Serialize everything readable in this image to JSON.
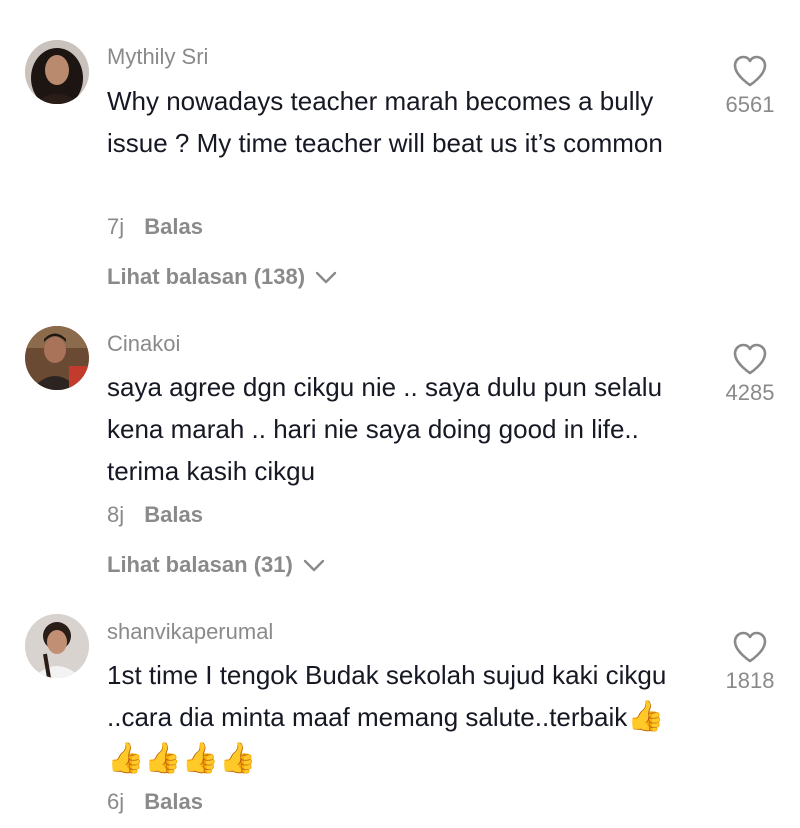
{
  "comments": [
    {
      "username": "Mythily Sri",
      "text": "Why nowadays teacher marah becomes a bully issue ? My time teacher will beat us it’s common",
      "time": "7j",
      "reply_label": "Balas",
      "view_replies": "Lihat balasan (138)",
      "likes": "6561",
      "avatar_icon": "user-avatar-woman"
    },
    {
      "username": "Cinakoi",
      "text": "saya agree dgn cikgu nie .. saya dulu pun selalu kena marah .. hari nie saya doing good in life.. terima kasih cikgu",
      "time": "8j",
      "reply_label": "Balas",
      "view_replies": "Lihat balasan (31)",
      "likes": "4285",
      "avatar_icon": "user-avatar-man"
    },
    {
      "username": "shanvikaperumal",
      "text": "1st time I tengok Budak sekolah sujud kaki cikgu ..cara dia minta maaf memang salute..terbaik",
      "emoji": "👍👍👍👍👍",
      "time": "6j",
      "reply_label": "Balas",
      "likes": "1818",
      "avatar_icon": "user-avatar-girl"
    }
  ],
  "icons": {
    "like": "heart-outline-icon",
    "expand": "chevron-down-icon"
  },
  "colors": {
    "text": "#161823",
    "secondary": "#8a8a8a",
    "background": "#ffffff"
  }
}
